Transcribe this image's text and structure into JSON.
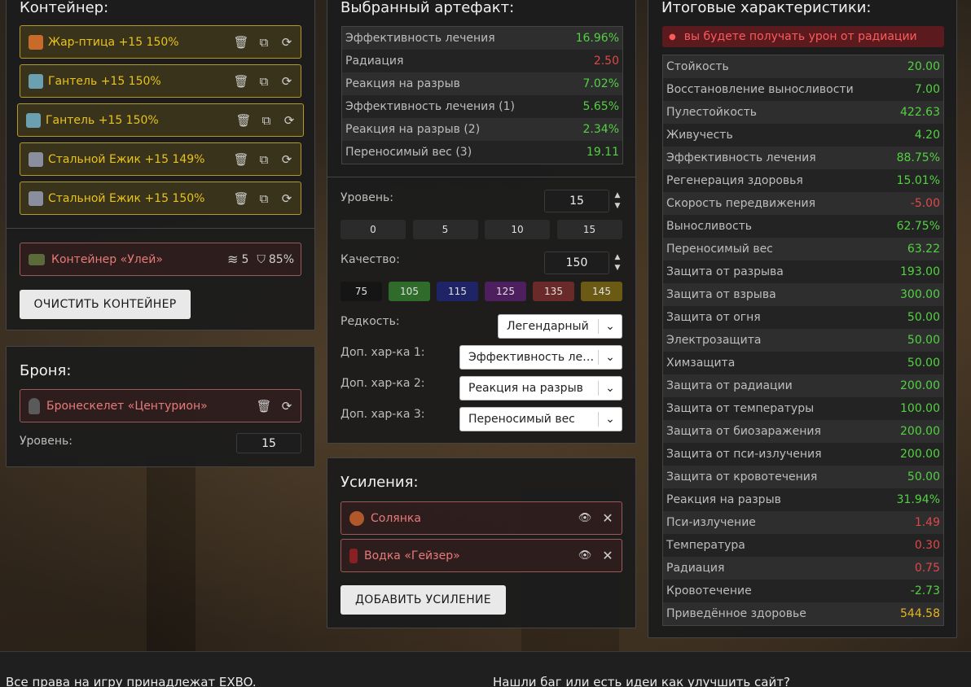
{
  "container": {
    "title": "Контейнер:",
    "items": [
      {
        "name": "Жар-птица +15 150%",
        "icon": "firebird-artifact-icon",
        "color": "#c96a2a"
      },
      {
        "name": "Гантель +15 150%",
        "icon": "dumbbell-artifact-icon",
        "color": "#6aa0b0"
      },
      {
        "name": "Гантель +15 150%",
        "icon": "dumbbell-artifact-icon",
        "color": "#6aa0b0"
      },
      {
        "name": "Стальной Ежик +15 149%",
        "icon": "steel-hedgehog-artifact-icon",
        "color": "#8a8fa0"
      },
      {
        "name": "Стальной Ежик +15 150%",
        "icon": "steel-hedgehog-artifact-icon",
        "color": "#8a8fa0"
      }
    ],
    "selected": {
      "name": "Контейнер «Улей»",
      "slots": "5",
      "protection": "85%"
    },
    "clear_label": "ОЧИСТИТЬ КОНТЕЙНЕР"
  },
  "armor": {
    "title": "Броня:",
    "item": "Бронескелет «Центурион»",
    "level_label": "Уровень:",
    "level_value": "15"
  },
  "artifact": {
    "title": "Выбранный артефакт:",
    "stats": [
      {
        "label": "Эффективность лечения",
        "value": "16.96%",
        "tone": "g"
      },
      {
        "label": "Радиация",
        "value": "2.50",
        "tone": "r"
      },
      {
        "label": "Реакция на разрыв",
        "value": "7.02%",
        "tone": "g"
      },
      {
        "label": "Эффективность лечения (1)",
        "value": "5.65%",
        "tone": "g"
      },
      {
        "label": "Реакция на разрыв (2)",
        "value": "2.34%",
        "tone": "g"
      },
      {
        "label": "Переносимый вес (3)",
        "value": "19.11",
        "tone": "g"
      }
    ],
    "level_label": "Уровень:",
    "level_value": "15",
    "level_presets": [
      "0",
      "5",
      "10",
      "15"
    ],
    "quality_label": "Качество:",
    "quality_value": "150",
    "quality_presets": [
      {
        "v": "75",
        "c": "#151515"
      },
      {
        "v": "105",
        "c": "#2f6b2a"
      },
      {
        "v": "115",
        "c": "#1e2466"
      },
      {
        "v": "125",
        "c": "#4e1f5e"
      },
      {
        "v": "135",
        "c": "#6b2a2a"
      },
      {
        "v": "145",
        "c": "#6b5a14"
      }
    ],
    "rarity_label": "Редкость:",
    "rarity_value": "Легендарный",
    "extra1_label": "Доп. хар-ка 1:",
    "extra1_value": "Эффективность лечения",
    "extra2_label": "Доп. хар-ка 2:",
    "extra2_value": "Реакция на разрыв",
    "extra3_label": "Доп. хар-ка 3:",
    "extra3_value": "Переносимый вес"
  },
  "boosts": {
    "title": "Усиления:",
    "items": [
      {
        "name": "Солянка",
        "icon": "solyanka-food-icon"
      },
      {
        "name": "Водка «Гейзер»",
        "icon": "vodka-bottle-icon"
      }
    ],
    "add_label": "ДОБАВИТЬ УСИЛЕНИЕ"
  },
  "totals": {
    "title": "Итоговые характеристики:",
    "warning": "вы будете получать урон от радиации",
    "stats": [
      {
        "label": "Стойкость",
        "value": "20.00",
        "tone": "g"
      },
      {
        "label": "Восстановление выносливости",
        "value": "7.00",
        "tone": "g"
      },
      {
        "label": "Пулестойкость",
        "value": "422.63",
        "tone": "g"
      },
      {
        "label": "Живучесть",
        "value": "4.20",
        "tone": "g"
      },
      {
        "label": "Эффективность лечения",
        "value": "88.75%",
        "tone": "g"
      },
      {
        "label": "Регенерация здоровья",
        "value": "15.01%",
        "tone": "g"
      },
      {
        "label": "Скорость передвижения",
        "value": "-5.00",
        "tone": "r"
      },
      {
        "label": "Выносливость",
        "value": "62.75%",
        "tone": "g"
      },
      {
        "label": "Переносимый вес",
        "value": "63.22",
        "tone": "g"
      },
      {
        "label": "Защита от разрыва",
        "value": "193.00",
        "tone": "g"
      },
      {
        "label": "Защита от взрыва",
        "value": "300.00",
        "tone": "g"
      },
      {
        "label": "Защита от огня",
        "value": "50.00",
        "tone": "g"
      },
      {
        "label": "Электрозащита",
        "value": "50.00",
        "tone": "g"
      },
      {
        "label": "Химзащита",
        "value": "50.00",
        "tone": "g"
      },
      {
        "label": "Защита от радиации",
        "value": "200.00",
        "tone": "g"
      },
      {
        "label": "Защита от температуры",
        "value": "100.00",
        "tone": "g"
      },
      {
        "label": "Защита от биозаражения",
        "value": "200.00",
        "tone": "g"
      },
      {
        "label": "Защита от пси-излучения",
        "value": "200.00",
        "tone": "g"
      },
      {
        "label": "Защита от кровотечения",
        "value": "50.00",
        "tone": "g"
      },
      {
        "label": "Реакция на разрыв",
        "value": "31.94%",
        "tone": "g"
      },
      {
        "label": "Пси-излучение",
        "value": "1.49",
        "tone": "r"
      },
      {
        "label": "Температура",
        "value": "0.30",
        "tone": "r"
      },
      {
        "label": "Радиация",
        "value": "0.75",
        "tone": "r"
      },
      {
        "label": "Кровотечение",
        "value": "-2.73",
        "tone": "g"
      },
      {
        "label": "Приведённое здоровье",
        "value": "544.58",
        "tone": "y"
      }
    ]
  },
  "footer": {
    "left": "Все права на игру принадлежат EXBO.",
    "right": "Нашли баг или есть идеи как улучшить сайт?"
  }
}
